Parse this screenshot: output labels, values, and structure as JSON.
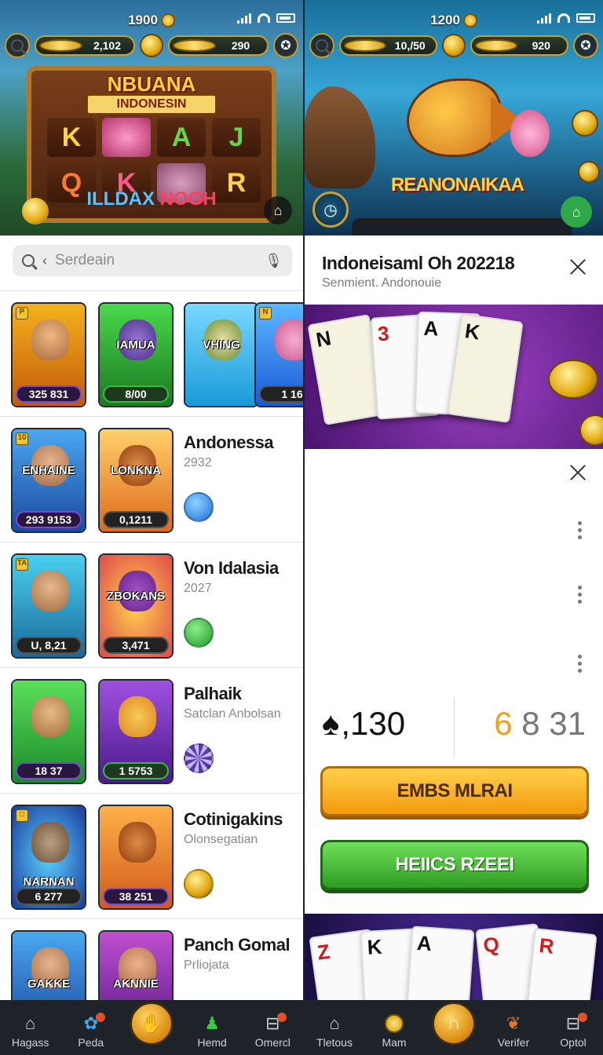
{
  "left": {
    "status": {
      "balance": "1900"
    },
    "topbar": {
      "coins1": "2,102",
      "coins2": "290"
    },
    "hero": {
      "title": "NBUANA",
      "subtitle": "INDONESIN",
      "reels": [
        "K",
        "",
        "A",
        "J",
        "Q",
        "K",
        "",
        "R"
      ],
      "footer_a": "ILLDAX",
      "footer_b": "NOGH"
    },
    "search": {
      "placeholder": "Serdeain"
    },
    "row1": {
      "thumbs": [
        {
          "label": "",
          "badge": "325 831"
        },
        {
          "label": "IAMUA",
          "badge": "8/00"
        },
        {
          "label": "VHING",
          "badge": ""
        },
        {
          "label": "",
          "badge": "1 16"
        }
      ]
    },
    "rows": [
      {
        "thumb1_label": "ENHAINE",
        "thumb1_badge": "293 9153",
        "thumb2_label": "LONKNA",
        "thumb2_badge": "0,1211",
        "title": "Andonessa",
        "sub": "2932"
      },
      {
        "thumb1_label": "",
        "thumb1_badge": "U, 8,21",
        "thumb2_label": "ZBOKANS",
        "thumb2_badge": "3,471",
        "title": "Von Idalasia",
        "sub": "2027"
      },
      {
        "thumb1_label": "",
        "thumb1_badge": "18 37",
        "thumb2_label": "",
        "thumb2_badge": "1 5753",
        "title": "Palhaik",
        "sub": "Satclan Anbolsan"
      },
      {
        "thumb1_label": "NARNAN",
        "thumb1_badge": "6 277",
        "thumb2_label": "",
        "thumb2_badge": "38 251",
        "title": "Cotinigakins",
        "sub": "Olonsegatian"
      },
      {
        "thumb1_label": "GAKKE",
        "thumb1_badge": "",
        "thumb2_label": "AKNNIE",
        "thumb2_badge": "",
        "title": "Panch Gomal",
        "sub": "Prliojata"
      }
    ],
    "nav": [
      {
        "label": "Hagass",
        "icon": "home-icon"
      },
      {
        "label": "Peda",
        "icon": "puzzle-icon"
      },
      {
        "label": "",
        "icon": "center-icon"
      },
      {
        "label": "Hemd",
        "icon": "person-icon"
      },
      {
        "label": "Omercl",
        "icon": "box-icon"
      }
    ]
  },
  "right": {
    "status": {
      "balance": "1200"
    },
    "topbar": {
      "coins1": "10,/50",
      "coins2": "920"
    },
    "hero": {
      "title": "REANONAIKAA"
    },
    "detail": {
      "title": "Indoneisaml Oh 202218",
      "subtitle": "Senmient. Andonouie"
    },
    "banner_cards": [
      "N",
      "3",
      "A",
      "K"
    ],
    "stats": {
      "left": ",130",
      "right_a": "6",
      "right_b": " 8 31"
    },
    "buttons": {
      "primary": "EMBS MLRAI",
      "secondary": "HEIICS RZEEI"
    },
    "bottom_cards": [
      "Z",
      "K",
      "A",
      "Q",
      "R"
    ],
    "nav": [
      {
        "label": "Tletous",
        "icon": "home-icon"
      },
      {
        "label": "Mam",
        "icon": "coins-icon"
      },
      {
        "label": "",
        "icon": "center-icon"
      },
      {
        "label": "Verifer",
        "icon": "leaf-icon"
      },
      {
        "label": "Optol",
        "icon": "box-icon"
      }
    ]
  }
}
